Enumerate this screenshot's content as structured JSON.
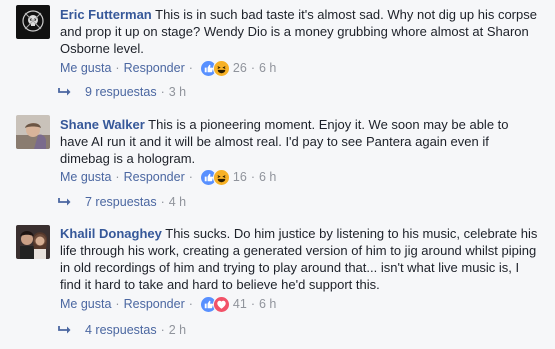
{
  "comments": [
    {
      "author": "Eric Futterman",
      "text": "This is in such bad taste it's almost sad. Why not dig up his corpse and prop it up on stage? Wendy Dio is a money grubbing whore almost at Sharon Osborne level.",
      "like_label": "Me gusta",
      "reply_label": "Responder",
      "reactions": [
        "like-icon",
        "haha-icon"
      ],
      "reaction_count": "26",
      "time": "6 h",
      "replies_label": "9 respuestas",
      "replies_time": "3 h"
    },
    {
      "author": "Shane Walker",
      "text": "This is a pioneering moment. Enjoy it. We soon may be able to have AI run it and it will be almost real. I'd pay to see Pantera again even if dimebag is a hologram.",
      "like_label": "Me gusta",
      "reply_label": "Responder",
      "reactions": [
        "like-icon",
        "haha-icon"
      ],
      "reaction_count": "16",
      "time": "6 h",
      "replies_label": "7 respuestas",
      "replies_time": "4 h"
    },
    {
      "author": "Khalil Donaghey",
      "text": "This sucks. Do him justice by listening to his music, celebrate his life through his work, creating a generated version of him to jig around whilst piping in old recordings of him and trying to play around that... isn't what live music is, I find it hard to take and hard to believe he'd support this.",
      "like_label": "Me gusta",
      "reply_label": "Responder",
      "reactions": [
        "like-icon",
        "love-icon"
      ],
      "reaction_count": "41",
      "time": "6 h",
      "replies_label": "4 respuestas",
      "replies_time": "2 h"
    }
  ],
  "separator": "·",
  "colors": {
    "author": "#365899",
    "link": "#4b67a1",
    "meta": "#90949c",
    "like": "#5890ff",
    "haha": "#f7b125",
    "love": "#f25268"
  }
}
